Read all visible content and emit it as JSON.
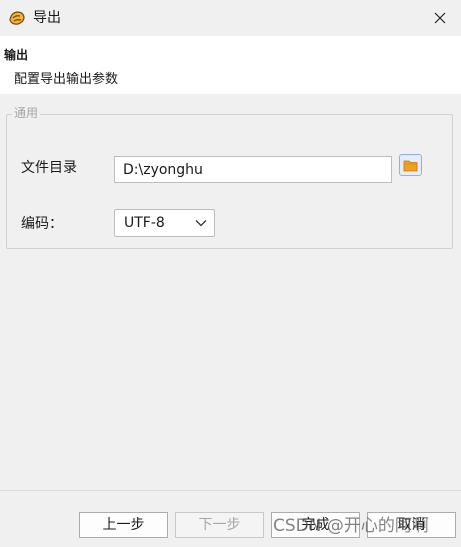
{
  "window": {
    "title": "导出",
    "app_icon": "app-logo-icon",
    "close_icon": "close-icon"
  },
  "header": {
    "title": "输出",
    "description": "配置导出输出参数"
  },
  "group": {
    "legend": "通用"
  },
  "fields": {
    "directory": {
      "label": "文件目录",
      "value": "D:\\zyonghu",
      "browse_icon": "folder-icon"
    },
    "encoding": {
      "label": "编码：",
      "value": "UTF-8",
      "chevron_icon": "chevron-down-icon"
    }
  },
  "buttons": {
    "back": "上一步",
    "next": "下一步",
    "finish": "完成",
    "cancel": "取消"
  },
  "watermark": "CSDN @开心的阿啊",
  "colors": {
    "window_bg": "#f0f0f0",
    "header_bg": "#ffffff",
    "folder_icon": "#f0a023",
    "folder_button_border": "#8fb3de",
    "disabled_text": "#a6a6a6"
  }
}
